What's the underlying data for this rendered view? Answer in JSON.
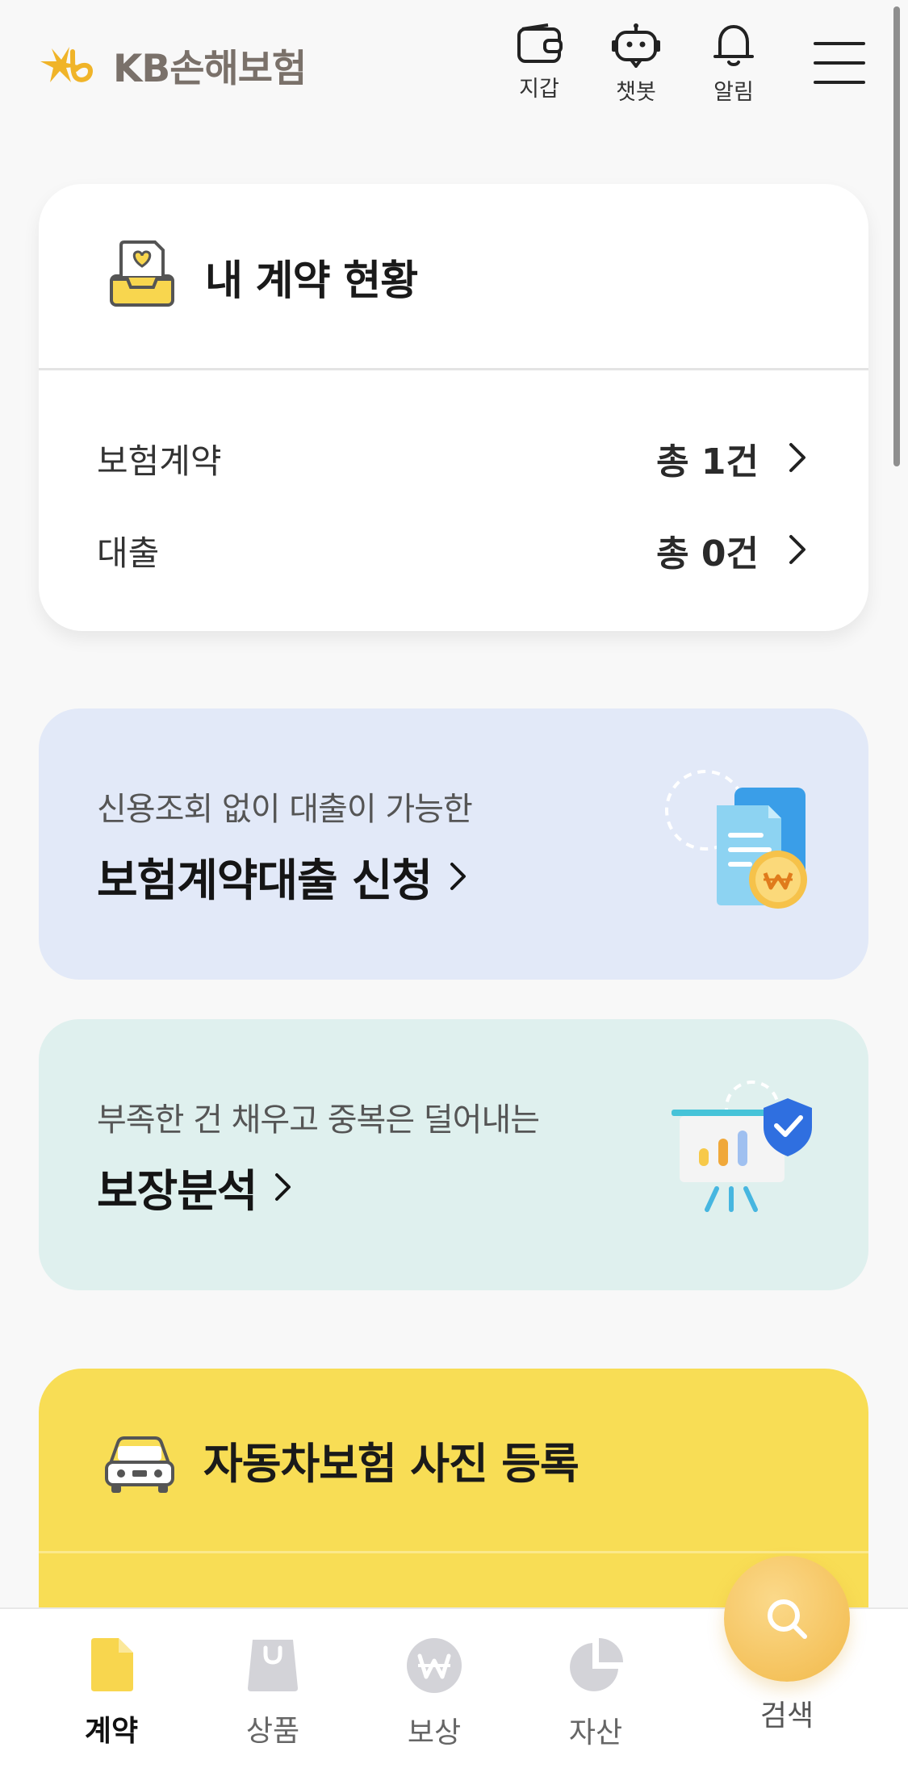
{
  "header": {
    "brand": "KB손해보험",
    "actions": [
      {
        "label": "지갑",
        "icon": "wallet-icon"
      },
      {
        "label": "챗봇",
        "icon": "chatbot-icon"
      },
      {
        "label": "알림",
        "icon": "bell-icon"
      }
    ],
    "menu_icon": "hamburger-menu-icon"
  },
  "contract_status": {
    "title": "내 계약 현황",
    "icon": "contract-inbox-icon",
    "rows": [
      {
        "label": "보험계약",
        "value": "총 1건"
      },
      {
        "label": "대출",
        "value": "총 0건"
      }
    ]
  },
  "loan_promo": {
    "subtitle": "신용조회 없이 대출이 가능한",
    "title": "보험계약대출 신청",
    "icon": "document-coin-icon"
  },
  "coverage_promo": {
    "subtitle": "부족한 건 채우고 중복은 덜어내는",
    "title": "보장분석",
    "icon": "chart-shield-icon"
  },
  "car_photo": {
    "title": "자동차보험 사진 등록",
    "icon": "car-icon"
  },
  "bottom_nav": {
    "items": [
      {
        "label": "계약",
        "icon": "contract-doc-icon",
        "active": true
      },
      {
        "label": "상품",
        "icon": "shopping-bag-icon",
        "active": false
      },
      {
        "label": "보상",
        "icon": "won-coin-icon",
        "active": false
      },
      {
        "label": "자산",
        "icon": "pie-chart-icon",
        "active": false
      }
    ],
    "search_label": "검색"
  },
  "colors": {
    "brand_yellow": "#f8dd55",
    "loan_bg": "#e2e9f8",
    "coverage_bg": "#dff0ee",
    "fab": "#f2b94a"
  }
}
